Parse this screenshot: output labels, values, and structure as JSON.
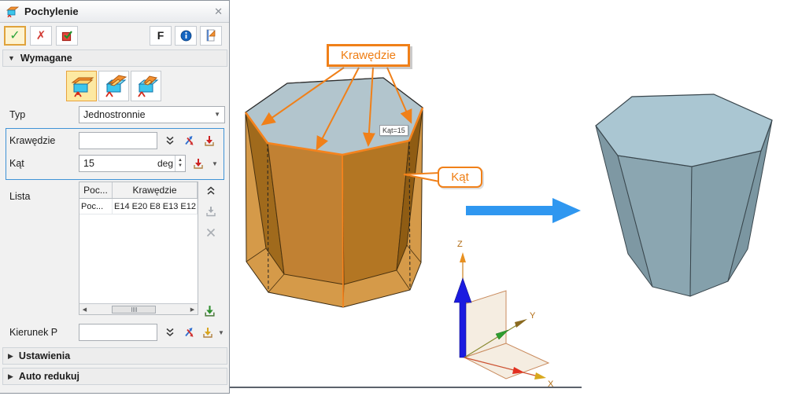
{
  "dialog": {
    "title": "Pochylenie",
    "toolbar": {
      "f": "F"
    },
    "sections": {
      "required": "Wymagane",
      "settings": "Ustawienia",
      "autoreduce": "Auto redukuj"
    },
    "typ": {
      "label": "Typ",
      "value": "Jednostronnie"
    },
    "edges": {
      "label": "Krawędzie",
      "value": ""
    },
    "angle": {
      "label": "Kąt",
      "value": "15",
      "unit": "deg"
    },
    "list": {
      "label": "Lista",
      "headers": [
        "Poc...",
        "Krawędzie"
      ],
      "row": [
        "Poc...",
        "E14 E20 E8 E13 E12"
      ]
    },
    "direction": {
      "label": "Kierunek P",
      "value": ""
    }
  },
  "viewport": {
    "edges_callout": "Krawędzie",
    "angle_callout": "Kąt",
    "angle_tooltip": "Kąt=15",
    "axes": {
      "x": "X",
      "y": "Y",
      "z": "Z"
    }
  },
  "glyphs": {
    "close": "✕",
    "check": "✓",
    "cross": "✗",
    "tri_down": "▼",
    "tri_right": "▶",
    "caret_down": "▼",
    "spin_up": "▲",
    "spin_down": "▼",
    "scroll_left": "◀",
    "scroll_right": "▶"
  },
  "colors": {
    "accent_orange": "#F08019",
    "highlight_edge": "#F5831D",
    "blue_arrow": "#2F97F0",
    "group_border": "#3F93D6",
    "top_face": "#B2C5CD",
    "draft_body": "#C8862E",
    "original_wall": "#D59A49",
    "result_body": "#8BA6B1",
    "selected_button_bg": "#FDF3D1",
    "selected_type_bg": "#FDE9A2"
  }
}
